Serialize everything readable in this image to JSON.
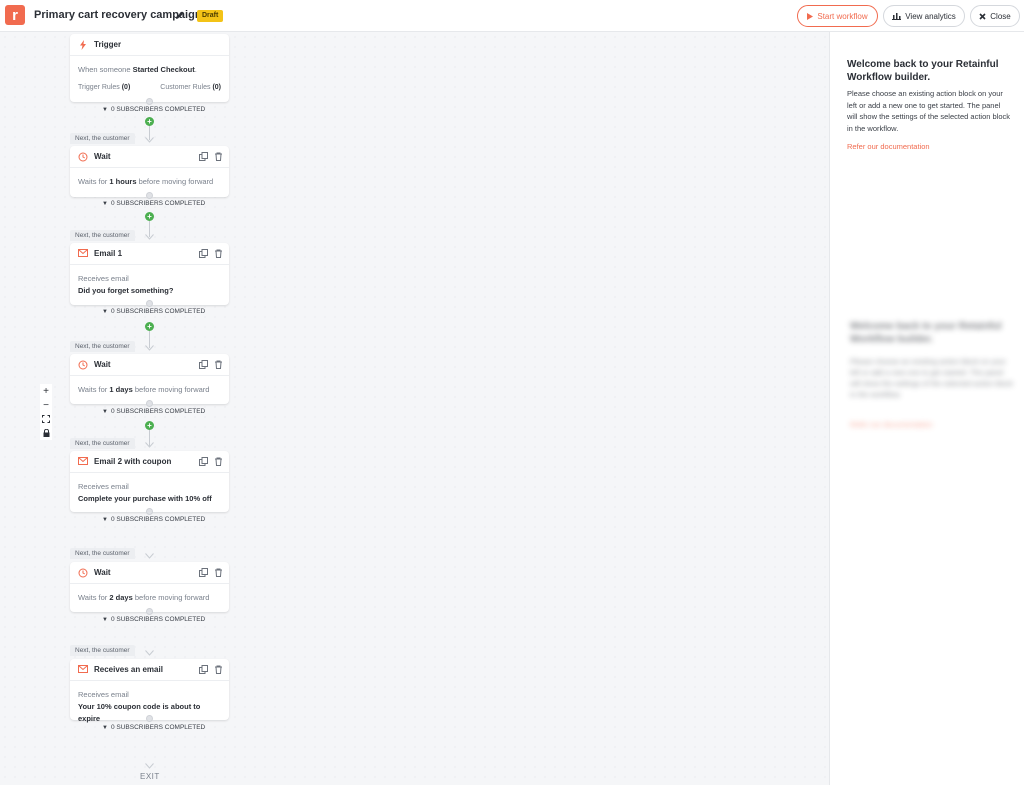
{
  "header": {
    "logo_letter": "r",
    "title": "Primary cart recovery campaign",
    "status_badge": "Draft",
    "start_label": "Start workflow",
    "analytics_label": "View analytics",
    "close_label": "Close"
  },
  "trigger": {
    "title": "Trigger",
    "desc_prefix": "When someone",
    "desc_event": "Started Checkout",
    "desc_suffix": ".",
    "trigger_rules_label": "Trigger Rules",
    "trigger_rules_count": "(0)",
    "customer_rules_label": "Customer Rules",
    "customer_rules_count": "(0)"
  },
  "subs_label": "0 SUBSCRIBERS COMPLETED",
  "next_label": "Next, the customer",
  "nodes": [
    {
      "title": "Wait",
      "pre": "Waits for",
      "value": "1 hours",
      "post": "before moving forward"
    },
    {
      "title": "Email 1",
      "line1": "Receives email",
      "line2": "Did you forget something?"
    },
    {
      "title": "Wait",
      "pre": "Waits for",
      "value": "1 days",
      "post": "before moving forward"
    },
    {
      "title": "Email 2 with coupon",
      "line1": "Receives email",
      "line2": "Complete your purchase with 10% off"
    },
    {
      "title": "Wait",
      "pre": "Waits for",
      "value": "2 days",
      "post": "before moving forward"
    },
    {
      "title": "Receives an email",
      "line1": "Receives email",
      "line2": "Your 10% coupon code is about to expire"
    }
  ],
  "exit_label": "EXIT",
  "zoom": {
    "in": "+",
    "out": "−"
  },
  "panel": {
    "heading": "Welcome back to your Retainful Workflow builder.",
    "body": "Please choose an existing action block on your left or add a new one to get started. The panel will show the settings of the selected action block in the workflow.",
    "doc_link": "Refer our documentation"
  },
  "colors": {
    "accent": "#f16b4f",
    "badge": "#f3c317",
    "add": "#4caf50"
  }
}
